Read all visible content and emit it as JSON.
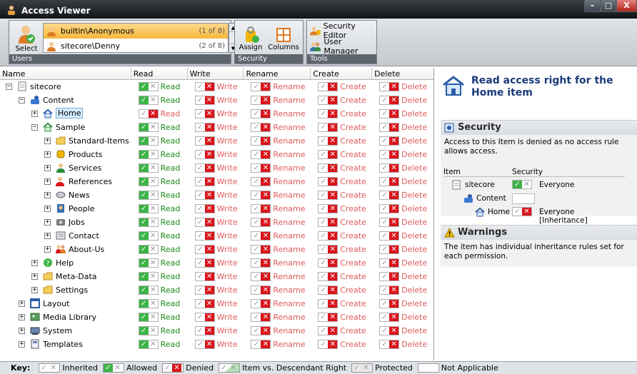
{
  "window": {
    "title": "Access Viewer",
    "minimize": "–",
    "maximize": "□",
    "close": "X"
  },
  "toolbar": {
    "users_group": {
      "select_label": "Select",
      "caption": "Users",
      "users": [
        {
          "name": "builtin\\Anonymous",
          "count": "(1 of 8)",
          "selected": true
        },
        {
          "name": "sitecore\\Denny",
          "count": "(2 of 8)",
          "selected": false
        }
      ]
    },
    "security_group": {
      "assign_label": "Assign",
      "columns_label": "Columns",
      "caption": "Security"
    },
    "tools_group": {
      "security_editor_label": "Security Editor",
      "user_manager_label": "User Manager",
      "caption": "Tools"
    }
  },
  "grid": {
    "headers": [
      "Name",
      "Read",
      "Write",
      "Rename",
      "Create",
      "Delete"
    ],
    "rows": [
      {
        "name": "sitecore",
        "icon": "document-icon",
        "depth": 0,
        "exp": "−",
        "read_state": "allowed"
      },
      {
        "name": "Content",
        "icon": "content-icon",
        "depth": 1,
        "exp": "−",
        "read_state": "allowed"
      },
      {
        "name": "Home",
        "icon": "home-icon",
        "depth": 2,
        "exp": "+",
        "read_state": "denied",
        "highlight": true
      },
      {
        "name": "Sample",
        "icon": "sample-icon",
        "depth": 2,
        "exp": "−",
        "read_state": "allowed"
      },
      {
        "name": "Standard-Items",
        "icon": "folder-icon",
        "depth": 3,
        "exp": "+",
        "read_state": "allowed"
      },
      {
        "name": "Products",
        "icon": "products-icon",
        "depth": 3,
        "exp": "+",
        "read_state": "allowed"
      },
      {
        "name": "Services",
        "icon": "services-icon",
        "depth": 3,
        "exp": "+",
        "read_state": "allowed"
      },
      {
        "name": "References",
        "icon": "references-icon",
        "depth": 3,
        "exp": "+",
        "read_state": "allowed"
      },
      {
        "name": "News",
        "icon": "news-icon",
        "depth": 3,
        "exp": "+",
        "read_state": "allowed"
      },
      {
        "name": "People",
        "icon": "people-icon",
        "depth": 3,
        "exp": "+",
        "read_state": "allowed"
      },
      {
        "name": "Jobs",
        "icon": "jobs-icon",
        "depth": 3,
        "exp": "+",
        "read_state": "allowed"
      },
      {
        "name": "Contact",
        "icon": "contact-icon",
        "depth": 3,
        "exp": "+",
        "read_state": "allowed"
      },
      {
        "name": "About-Us",
        "icon": "about-icon",
        "depth": 3,
        "exp": "+",
        "read_state": "allowed"
      },
      {
        "name": "Help",
        "icon": "help-icon",
        "depth": 2,
        "exp": "+",
        "read_state": "allowed"
      },
      {
        "name": "Meta-Data",
        "icon": "folder-icon",
        "depth": 2,
        "exp": "+",
        "read_state": "allowed"
      },
      {
        "name": "Settings",
        "icon": "folder-icon",
        "depth": 2,
        "exp": "+",
        "read_state": "allowed"
      },
      {
        "name": "Layout",
        "icon": "layout-icon",
        "depth": 1,
        "exp": "+",
        "read_state": "allowed"
      },
      {
        "name": "Media Library",
        "icon": "media-icon",
        "depth": 1,
        "exp": "+",
        "read_state": "allowed"
      },
      {
        "name": "System",
        "icon": "system-icon",
        "depth": 1,
        "exp": "+",
        "read_state": "allowed"
      },
      {
        "name": "Templates",
        "icon": "templates-icon",
        "depth": 1,
        "exp": "+",
        "read_state": "allowed"
      }
    ],
    "perm_labels": [
      "Read",
      "Write",
      "Rename",
      "Create",
      "Delete"
    ]
  },
  "right_panel": {
    "title": "Read access right for the Home item",
    "security": {
      "heading": "Security",
      "text": "Access to this Item is denied as no access rule allows access.",
      "col_item": "Item",
      "col_security": "Security",
      "items": [
        {
          "name": "sitecore",
          "rule": "Everyone",
          "state": "allowed"
        },
        {
          "name": "Content",
          "rule": "",
          "state": "none"
        },
        {
          "name": "Home",
          "rule": "Everyone [Inheritance]",
          "state": "denied"
        }
      ]
    },
    "warnings": {
      "heading": "Warnings",
      "text": "The item has individual inheritance rules set for each permission."
    }
  },
  "key": {
    "label": "Key:",
    "items": [
      "Inherited",
      "Allowed",
      "Denied",
      "Item vs. Descendant Right",
      "Protected",
      "Not Applicable"
    ]
  },
  "colors": {
    "allowed": "#3cb447",
    "denied": "#d9141b",
    "accent_title": "#1a3b7a"
  }
}
